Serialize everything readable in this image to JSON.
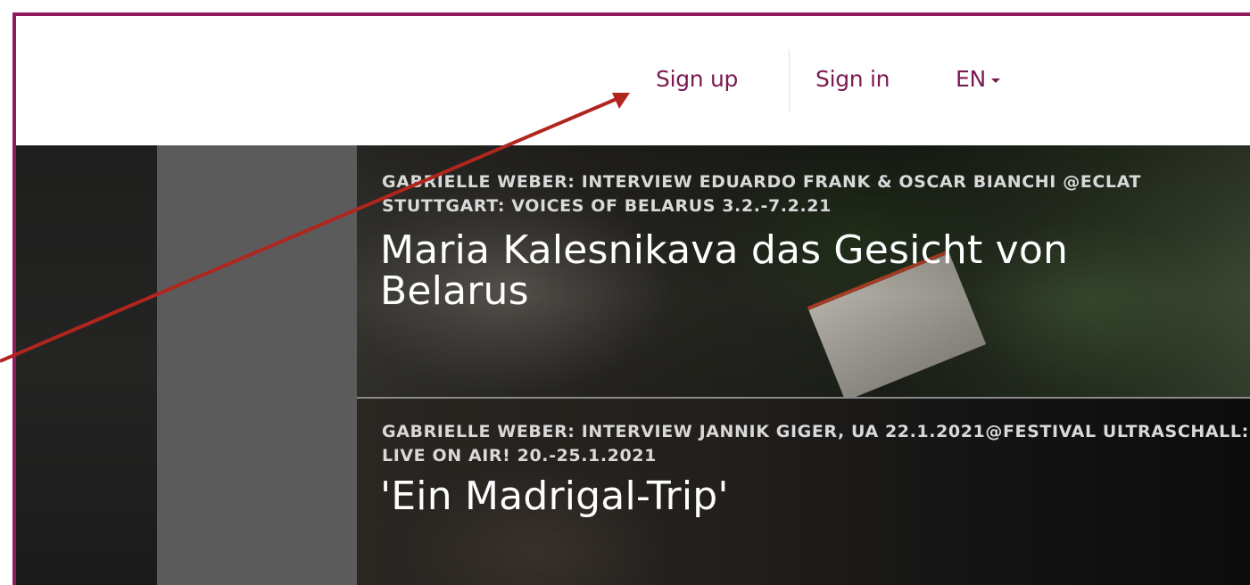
{
  "header": {
    "sign_up": "Sign up",
    "sign_in": "Sign in",
    "language": "EN"
  },
  "articles": [
    {
      "kicker": "GABRIELLE WEBER: INTERVIEW EDUARDO FRANK & OSCAR BIANCHI @ECLAT STUTTGART: VOICES OF BELARUS 3.2.-7.2.21",
      "title": "Maria Kalesnikava das Gesicht von Belarus"
    },
    {
      "kicker": "GABRIELLE WEBER: INTERVIEW JANNIK GIGER, UA 22.1.2021@FESTIVAL ULTRASCHALL: LIVE ON AIR! 20.-25.1.2021",
      "title": "'Ein Madrigal-Trip'"
    }
  ],
  "colors": {
    "brand": "#8e1a5c",
    "nav_text": "#7b1a52",
    "annotation_arrow": "#b0261e"
  },
  "icons": {
    "language_caret": "caret-down-icon"
  }
}
